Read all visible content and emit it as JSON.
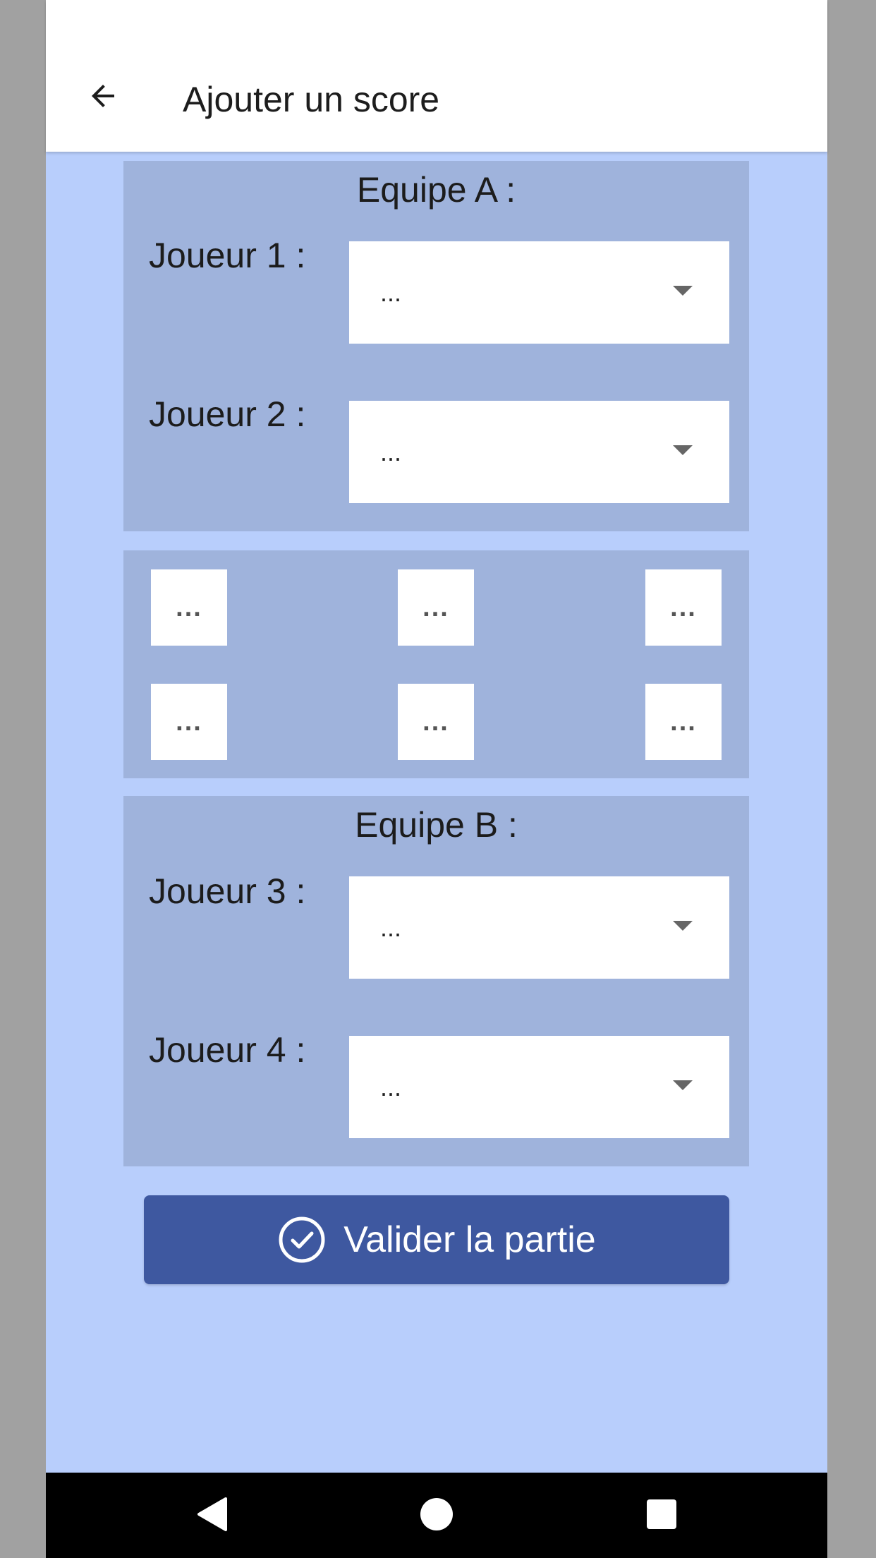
{
  "appbar": {
    "back_icon": "arrow-left-icon",
    "title": "Ajouter un score"
  },
  "team_a": {
    "title": "Equipe A :",
    "players": [
      {
        "label": "Joueur 1 :",
        "value": "..."
      },
      {
        "label": "Joueur 2 :",
        "value": "..."
      }
    ]
  },
  "scores": {
    "row1": [
      "...",
      "...",
      "..."
    ],
    "row2": [
      "...",
      "...",
      "..."
    ]
  },
  "team_b": {
    "title": "Equipe B :",
    "players": [
      {
        "label": "Joueur 3 :",
        "value": "..."
      },
      {
        "label": "Joueur 4 :",
        "value": "..."
      }
    ]
  },
  "validate": {
    "icon": "check-circle-icon",
    "label": "Valider la partie",
    "color": "#3e58a0"
  },
  "colors": {
    "background": "#b8cefc",
    "panel": "#9fb3dc",
    "appbar": "#ffffff"
  },
  "navbar": {
    "icons": [
      "back-triangle-icon",
      "home-circle-icon",
      "recents-square-icon"
    ]
  }
}
